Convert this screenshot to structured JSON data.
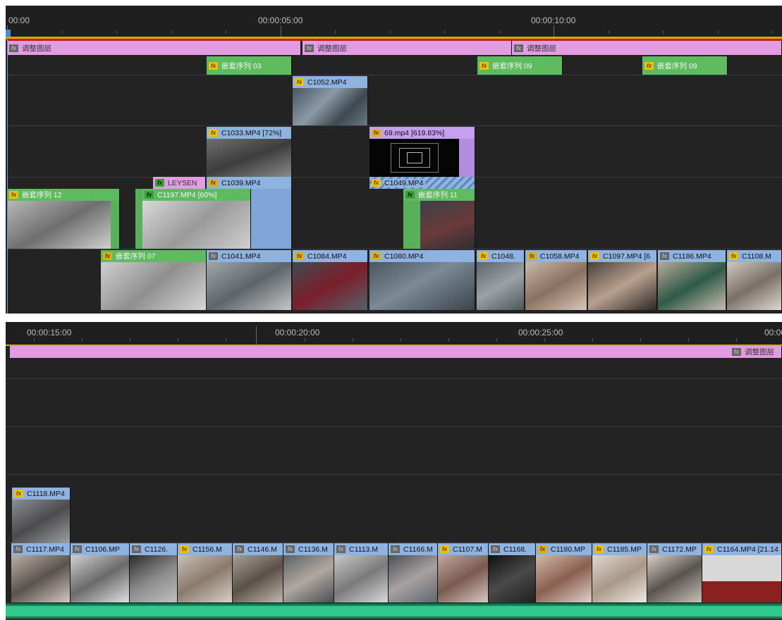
{
  "top_panel": {
    "timecodes": [
      "00:00",
      "00:00:05:00",
      "00:00:10:00"
    ],
    "track_v7": [
      {
        "label": "调整图层"
      },
      {
        "label": "调整图层"
      },
      {
        "label": "调整图层"
      }
    ],
    "track_v6": [
      {
        "label": "嵌套序列 03"
      },
      {
        "label": "嵌套序列 09"
      },
      {
        "label": "嵌套序列 09"
      }
    ],
    "track_v5": [
      {
        "label": "C1052.MP4"
      }
    ],
    "track_v4": [
      {
        "label": "C1033.MP4 [72%]"
      },
      {
        "label": "69.mp4 [619.83%]"
      }
    ],
    "track_v3": [
      {
        "label": "LEYSEN"
      },
      {
        "label": "C1039.MP4"
      },
      {
        "label": "C1049.MP4"
      }
    ],
    "track_v2": [
      {
        "label": "嵌套序列 12"
      },
      {
        "label": "C1197.MP4 [60%]"
      },
      {
        "label": "嵌套序列 11"
      }
    ],
    "track_v1": [
      {
        "label": "嵌套序列 07"
      },
      {
        "label": "C1041.MP4"
      },
      {
        "label": "C1084.MP4"
      },
      {
        "label": "C1080.MP4"
      },
      {
        "label": "C1048."
      },
      {
        "label": "C1058.MP4"
      },
      {
        "label": "C1097.MP4 [6"
      },
      {
        "label": "C1186.MP4"
      },
      {
        "label": "C1108.M"
      }
    ]
  },
  "bottom_panel": {
    "timecodes": [
      "00:00:15:00",
      "00:00:20:00",
      "00:00:25:00",
      "00:00"
    ],
    "track_v7": [
      {
        "label": "调整图层"
      }
    ],
    "track_v2": [
      {
        "label": "C1118.MP4"
      }
    ],
    "track_v1": [
      {
        "label": "C1117.MP4"
      },
      {
        "label": "C1106.MP"
      },
      {
        "label": "C1126."
      },
      {
        "label": "C1156.M"
      },
      {
        "label": "C1146.M"
      },
      {
        "label": "C1136.M"
      },
      {
        "label": "C1113.M"
      },
      {
        "label": "C1166.M"
      },
      {
        "label": "C1107.M"
      },
      {
        "label": "C1168."
      },
      {
        "label": "C1180.MP"
      },
      {
        "label": "C1185.MP"
      },
      {
        "label": "C1172.MP"
      },
      {
        "label": "C1164.MP4 [21.14"
      }
    ]
  },
  "fx_label": "fx",
  "colors": {
    "video_clip": "#8fb3e0",
    "nested_sequence": "#5fbb60",
    "adjustment_layer": "#e39be2",
    "audio_waveform": "#2fc98c",
    "playhead": "#6d9fe8"
  }
}
